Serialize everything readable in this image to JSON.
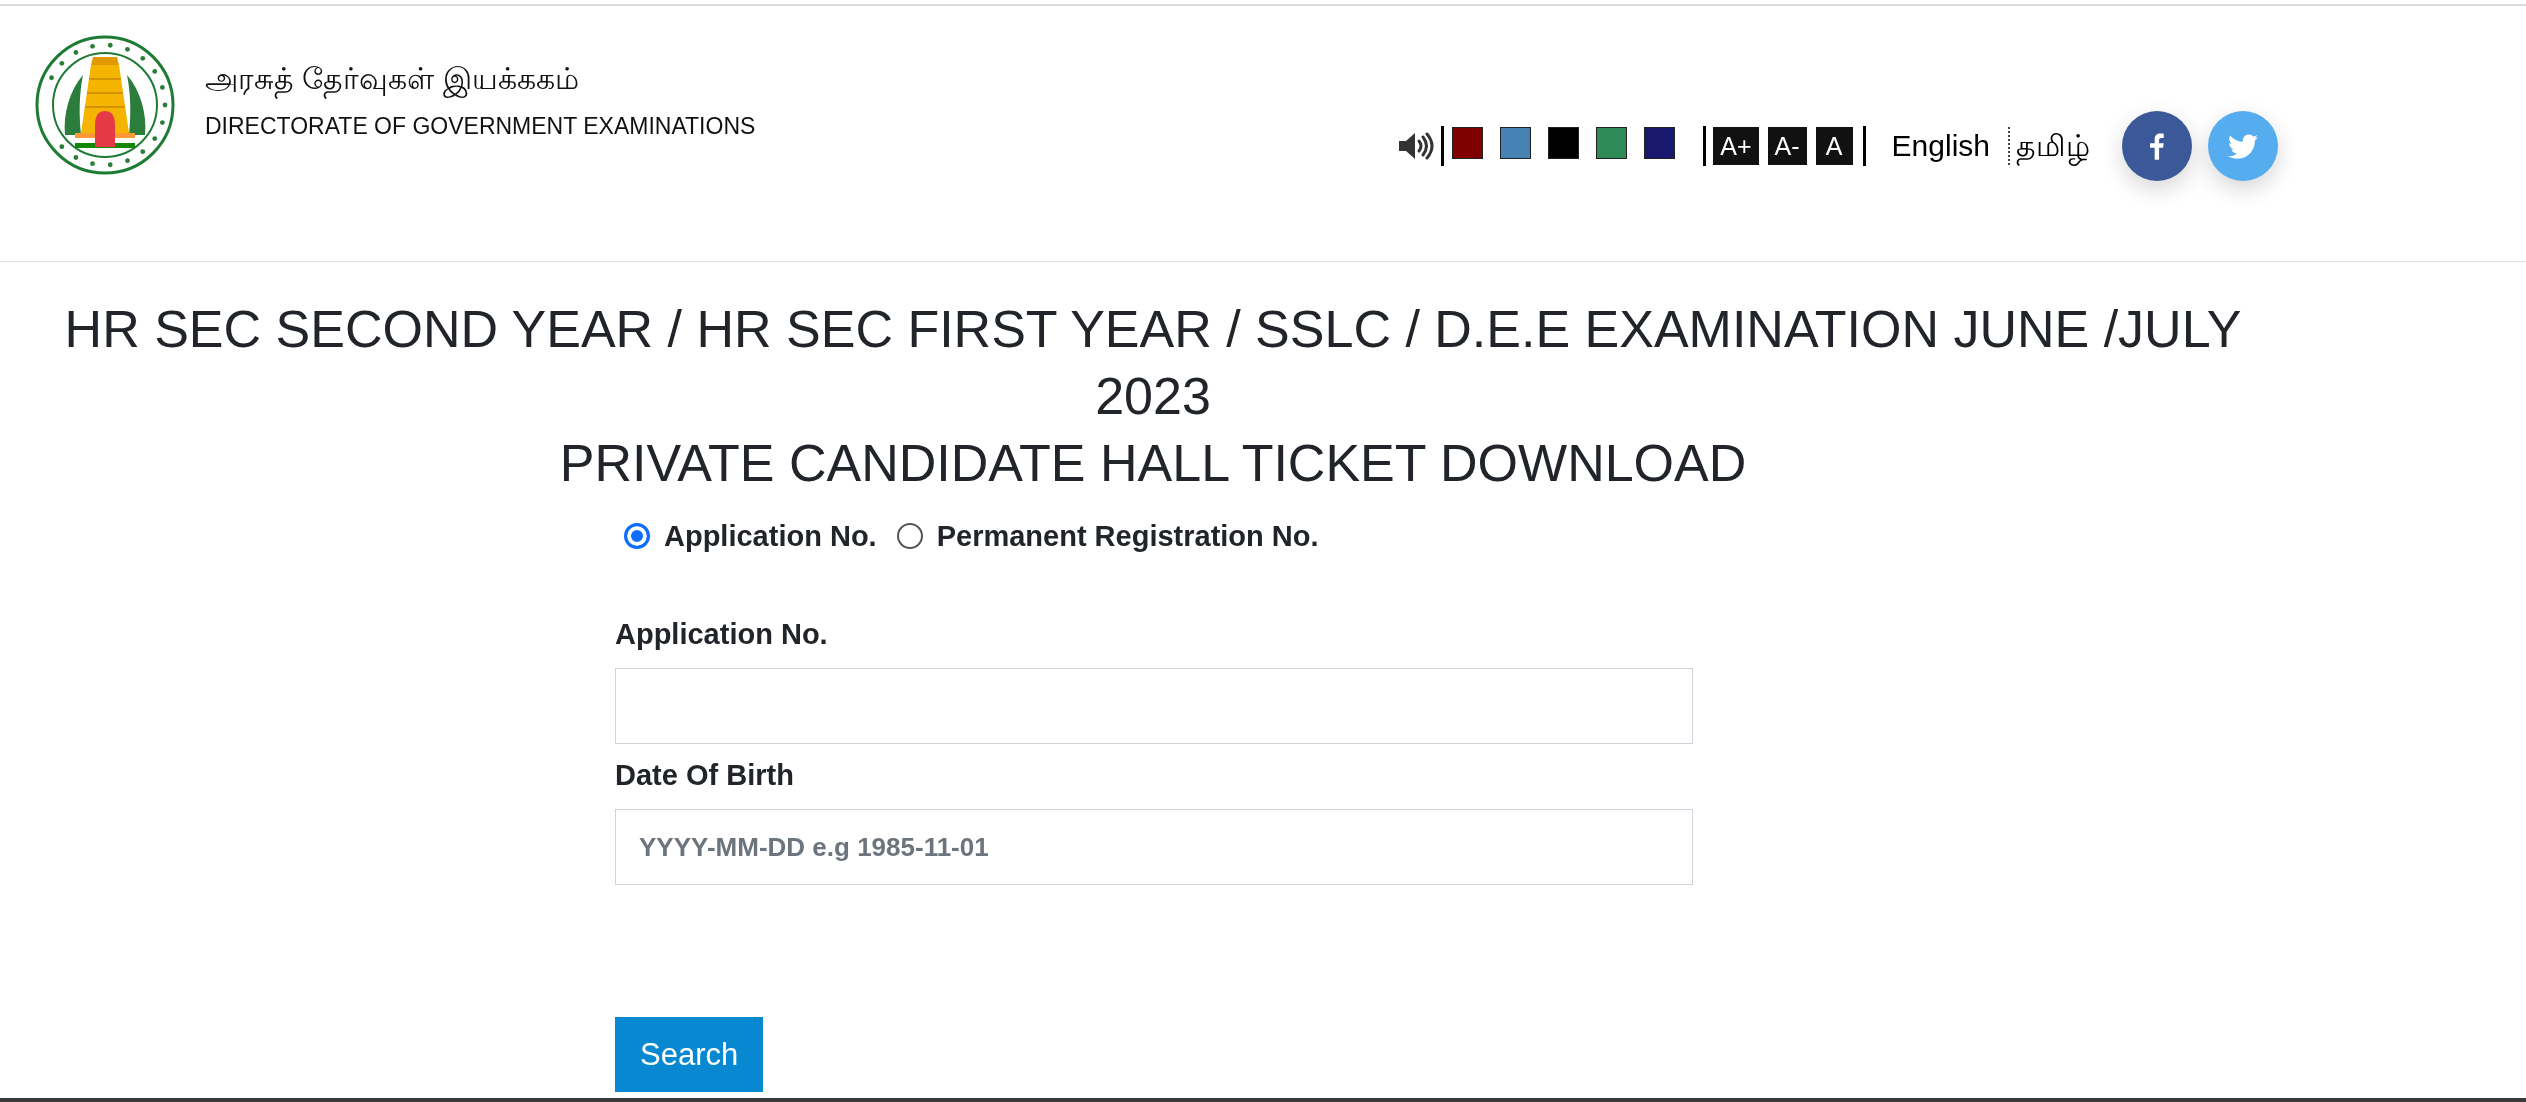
{
  "header": {
    "title_tamil": "அரசுத் தேர்வுகள் இயக்ககம்",
    "title_english": "DIRECTORATE OF GOVERNMENT EXAMINATIONS"
  },
  "toolbar": {
    "theme_colors": [
      {
        "color": "#800000"
      },
      {
        "color": "#4682b4"
      },
      {
        "color": "#000000"
      },
      {
        "color": "#2e8b57"
      },
      {
        "color": "#191970"
      }
    ],
    "font_size_buttons": [
      "A+",
      "A-",
      "A"
    ],
    "languages": [
      "English",
      "தமிழ்"
    ]
  },
  "heading_lines": [
    "HR SEC SECOND YEAR / HR SEC FIRST YEAR / SSLC / D.E.E EXAMINATION JUNE /JULY 2023",
    "PRIVATE CANDIDATE HALL TICKET DOWNLOAD"
  ],
  "search_by": [
    {
      "label": "Application No.",
      "selected": true
    },
    {
      "label": "Permanent Registration No.",
      "selected": false
    }
  ],
  "fields": [
    {
      "label": "Application No."
    },
    {
      "label": "Date Of Birth",
      "placeholder": "YYYY-MM-DD e.g 1985-11-01"
    }
  ],
  "submit_button": "Search"
}
